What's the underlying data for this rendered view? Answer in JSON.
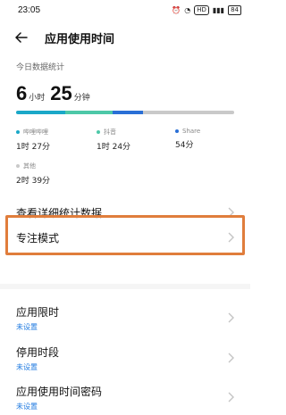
{
  "status_bar": {
    "time": "23:05",
    "network_label": "HD",
    "battery_level": "84"
  },
  "header": {
    "title": "应用使用时间"
  },
  "stats": {
    "section_label": "今日数据统计",
    "total_hours": "6",
    "hours_unit": "小时",
    "total_minutes": "25",
    "minutes_unit": "分钟",
    "apps": [
      {
        "name": "哔哩哔哩",
        "time": "1时 27分",
        "color": "#1aa8c8"
      },
      {
        "name": "抖音",
        "time": "1时 24分",
        "color": "#4dc8a8"
      },
      {
        "name": "Share",
        "time": "54分",
        "color": "#2a6fd6"
      },
      {
        "name": "其他",
        "time": "2时 39分",
        "color": "#c9c9c9"
      }
    ],
    "share_of_total": [
      0.226,
      0.218,
      0.14,
      0.416
    ]
  },
  "items": [
    {
      "label": "查看详细统计数据",
      "sub": ""
    },
    {
      "label": "专注模式",
      "sub": ""
    },
    {
      "label": "应用限时",
      "sub": "未设置"
    },
    {
      "label": "停用时段",
      "sub": "未设置"
    },
    {
      "label": "应用使用时间密码",
      "sub": "未设置"
    }
  ],
  "highlight_color": "#e07d3c"
}
